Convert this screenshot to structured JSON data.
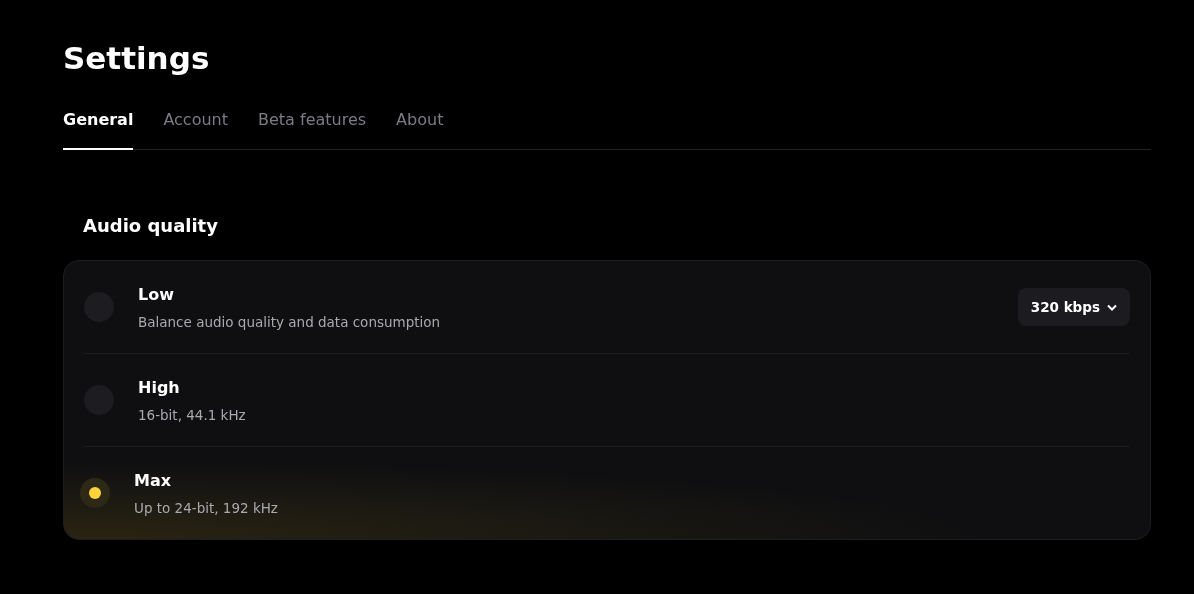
{
  "page": {
    "title": "Settings"
  },
  "tabs": [
    {
      "label": "General",
      "selected": true
    },
    {
      "label": "Account",
      "selected": false
    },
    {
      "label": "Beta features",
      "selected": false
    },
    {
      "label": "About",
      "selected": false
    }
  ],
  "section": {
    "title": "Audio quality"
  },
  "options": [
    {
      "label": "Low",
      "description": "Balance audio quality and data consumption",
      "selected": false,
      "dropdown": "320 kbps"
    },
    {
      "label": "High",
      "description": "16-bit, 44.1 kHz",
      "selected": false
    },
    {
      "label": "Max",
      "description": "Up to 24-bit, 192 kHz",
      "selected": true
    }
  ]
}
